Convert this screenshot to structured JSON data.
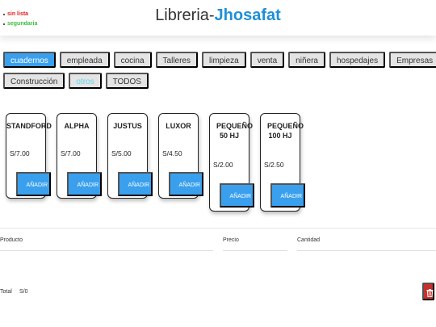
{
  "legend": {
    "items": [
      {
        "label": "sin lista",
        "color": "#e02020"
      },
      {
        "label": "segundaria",
        "color": "#3cc03c"
      }
    ]
  },
  "brand": {
    "prefix": "Libreria-",
    "accent": "Jhosafat",
    "accent_color": "#1e90d8"
  },
  "categories": {
    "row1": [
      "cuadernos",
      "empleada",
      "cocina",
      "Talleres",
      "limpieza",
      "venta",
      "niñera",
      "hospedajes",
      "Empresas"
    ],
    "row2": [
      "Construcción",
      "otros",
      "TODOS"
    ],
    "active": "cuadernos"
  },
  "products": [
    {
      "name": "STANDFORD",
      "price": "S/7.00",
      "button": "AÑADIR"
    },
    {
      "name": "ALPHA",
      "price": "S/7.00",
      "button": "AÑADIR"
    },
    {
      "name": "JUSTUS",
      "price": "S/5.00",
      "button": "AÑADIR"
    },
    {
      "name": "LUXOR",
      "price": "S/4.50",
      "button": "AÑADIR"
    },
    {
      "name": "PEQUEÑO 50 HJ",
      "price": "S/2.00",
      "button": "AÑADIR"
    },
    {
      "name": "PEQUEÑO 100 HJ",
      "price": "S/2.50",
      "button": "AÑADIR"
    }
  ],
  "table": {
    "headers": [
      "Producto",
      "Precio",
      "Cantidad"
    ]
  },
  "totals": {
    "label": "Total",
    "value": "S/0"
  },
  "colors": {
    "primary": "#3aa0ee",
    "danger": "#c9302c"
  },
  "icons": {
    "clear_cart": "trash-icon"
  }
}
